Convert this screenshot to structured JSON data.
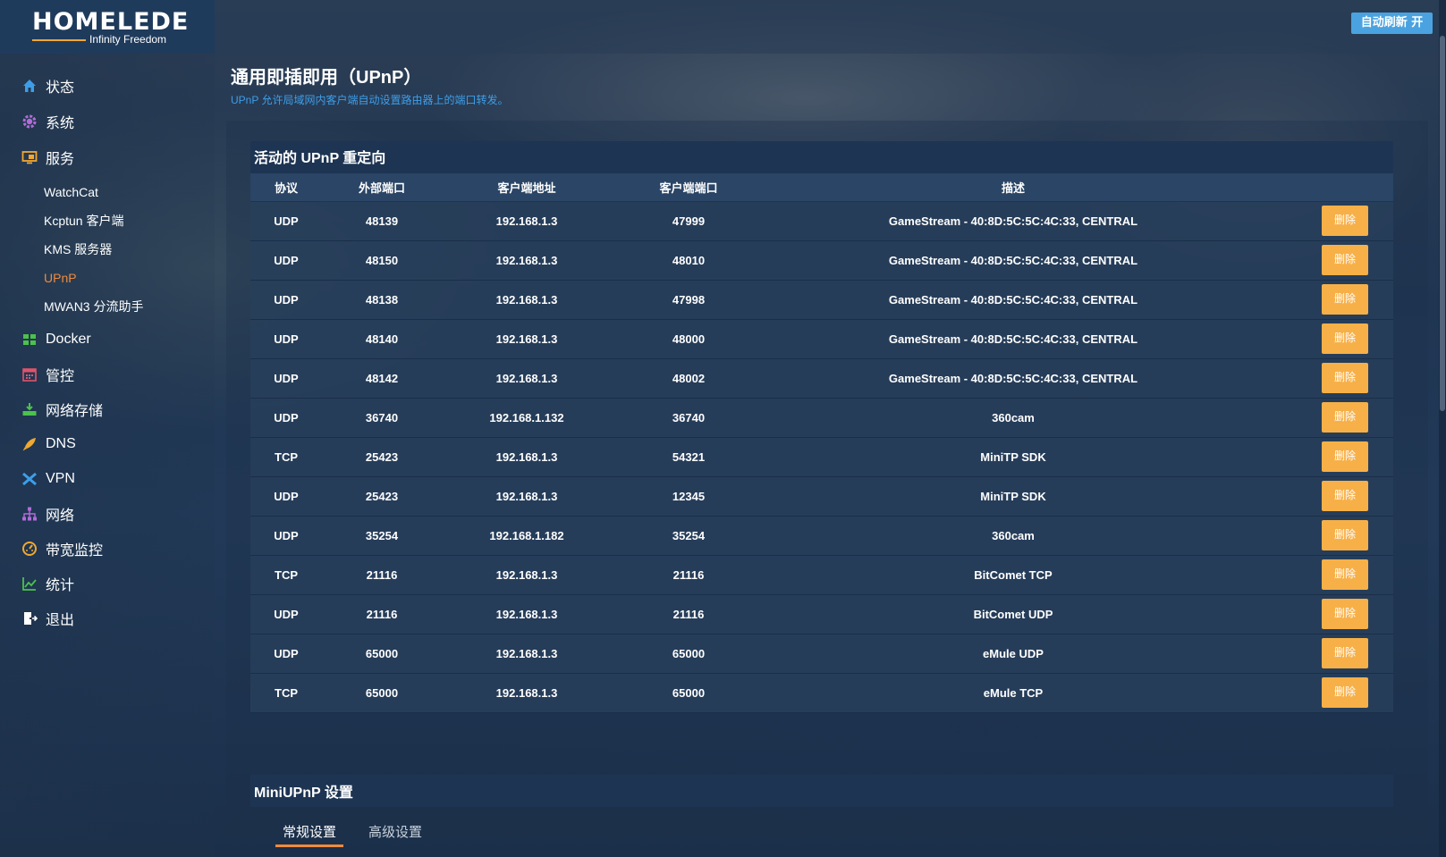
{
  "header": {
    "logo_main": "HOMELEDE",
    "logo_sub": "Infinity Freedom",
    "refresh_label": "自动刷新 开"
  },
  "sidebar": {
    "items": [
      {
        "label": "状态",
        "icon": "home-icon",
        "color": "#3d9ee8"
      },
      {
        "label": "系统",
        "icon": "gear-icon",
        "color": "#b26bd8"
      },
      {
        "label": "服务",
        "icon": "services-icon",
        "color": "#f0a830"
      },
      {
        "label": "Docker",
        "icon": "docker-icon",
        "color": "#4cc14c"
      },
      {
        "label": "管控",
        "icon": "calendar-icon",
        "color": "#e0546b"
      },
      {
        "label": "网络存储",
        "icon": "storage-icon",
        "color": "#4cc14c"
      },
      {
        "label": "DNS",
        "icon": "rocket-icon",
        "color": "#f0a830"
      },
      {
        "label": "VPN",
        "icon": "plane-icon",
        "color": "#3d9ee8"
      },
      {
        "label": "网络",
        "icon": "network-icon",
        "color": "#b26bd8"
      },
      {
        "label": "带宽监控",
        "icon": "gauge-icon",
        "color": "#f0a830"
      },
      {
        "label": "统计",
        "icon": "chart-icon",
        "color": "#4cc14c"
      },
      {
        "label": "退出",
        "icon": "logout-icon",
        "color": "#ffffff"
      }
    ],
    "sub_items": [
      {
        "label": "WatchCat"
      },
      {
        "label": "Kcptun 客户端"
      },
      {
        "label": "KMS 服务器"
      },
      {
        "label": "UPnP"
      },
      {
        "label": "MWAN3 分流助手"
      }
    ]
  },
  "page": {
    "title": "通用即插即用（UPnP）",
    "description": "UPnP 允许局域网内客户端自动设置路由器上的端口转发。"
  },
  "redirects": {
    "title": "活动的 UPnP 重定向",
    "columns": [
      "协议",
      "外部端口",
      "客户端地址",
      "客户端端口",
      "描述"
    ],
    "delete_label": "删除",
    "rows": [
      {
        "proto": "UDP",
        "ext_port": "48139",
        "client_addr": "192.168.1.3",
        "client_port": "47999",
        "desc": "GameStream - 40:8D:5C:5C:4C:33, CENTRAL"
      },
      {
        "proto": "UDP",
        "ext_port": "48150",
        "client_addr": "192.168.1.3",
        "client_port": "48010",
        "desc": "GameStream - 40:8D:5C:5C:4C:33, CENTRAL"
      },
      {
        "proto": "UDP",
        "ext_port": "48138",
        "client_addr": "192.168.1.3",
        "client_port": "47998",
        "desc": "GameStream - 40:8D:5C:5C:4C:33, CENTRAL"
      },
      {
        "proto": "UDP",
        "ext_port": "48140",
        "client_addr": "192.168.1.3",
        "client_port": "48000",
        "desc": "GameStream - 40:8D:5C:5C:4C:33, CENTRAL"
      },
      {
        "proto": "UDP",
        "ext_port": "48142",
        "client_addr": "192.168.1.3",
        "client_port": "48002",
        "desc": "GameStream - 40:8D:5C:5C:4C:33, CENTRAL"
      },
      {
        "proto": "UDP",
        "ext_port": "36740",
        "client_addr": "192.168.1.132",
        "client_port": "36740",
        "desc": "360cam"
      },
      {
        "proto": "TCP",
        "ext_port": "25423",
        "client_addr": "192.168.1.3",
        "client_port": "54321",
        "desc": "MiniTP SDK"
      },
      {
        "proto": "UDP",
        "ext_port": "25423",
        "client_addr": "192.168.1.3",
        "client_port": "12345",
        "desc": "MiniTP SDK"
      },
      {
        "proto": "UDP",
        "ext_port": "35254",
        "client_addr": "192.168.1.182",
        "client_port": "35254",
        "desc": "360cam"
      },
      {
        "proto": "TCP",
        "ext_port": "21116",
        "client_addr": "192.168.1.3",
        "client_port": "21116",
        "desc": "BitComet TCP"
      },
      {
        "proto": "UDP",
        "ext_port": "21116",
        "client_addr": "192.168.1.3",
        "client_port": "21116",
        "desc": "BitComet UDP"
      },
      {
        "proto": "UDP",
        "ext_port": "65000",
        "client_addr": "192.168.1.3",
        "client_port": "65000",
        "desc": "eMule UDP"
      },
      {
        "proto": "TCP",
        "ext_port": "65000",
        "client_addr": "192.168.1.3",
        "client_port": "65000",
        "desc": "eMule TCP"
      }
    ]
  },
  "miniupnp": {
    "title": "MiniUPnP 设置",
    "tabs": [
      {
        "label": "常规设置",
        "active": true
      },
      {
        "label": "高级设置",
        "active": false
      }
    ]
  },
  "colors": {
    "accent": "#3d9ee8",
    "active_nav": "#f08a3c",
    "delete_button": "#f7b047",
    "refresh_button": "#4aa3e0"
  }
}
